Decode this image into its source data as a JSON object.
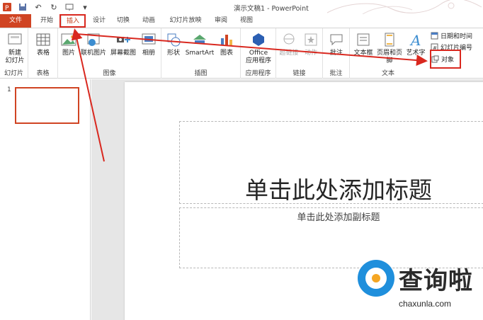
{
  "window": {
    "title": "演示文稿1 - PowerPoint"
  },
  "tabs": [
    {
      "label": "文件"
    },
    {
      "label": "开始"
    },
    {
      "label": "插入"
    },
    {
      "label": "设计"
    },
    {
      "label": "切换"
    },
    {
      "label": "动画"
    },
    {
      "label": "幻灯片放映"
    },
    {
      "label": "审阅"
    },
    {
      "label": "视图"
    }
  ],
  "ribbon": {
    "groups": {
      "slides": "幻灯片",
      "tables": "表格",
      "images": "图像",
      "illustrations": "插图",
      "apps": "应用程序",
      "links": "链接",
      "comments": "批注",
      "text": "文本"
    },
    "commands": {
      "new_slide_1": "新建",
      "new_slide_2": "幻灯片",
      "table": "表格",
      "pictures": "图片",
      "online_pictures": "联机图片",
      "screenshot": "屏幕截图",
      "album": "相册",
      "shapes": "形状",
      "smartart": "SmartArt",
      "chart": "图表",
      "office_1": "Office",
      "office_2": "应用程序",
      "hyperlink": "超链接",
      "action": "动作",
      "comment": "批注",
      "textbox": "文本框",
      "header_footer": "页眉和页脚",
      "wordart": "艺术字",
      "datetime": "日期和时间",
      "slide_number": "幻灯片编号",
      "object": "对象"
    }
  },
  "thumbnail": {
    "number": "1"
  },
  "slide": {
    "title": "单击此处添加标题",
    "subtitle": "单击此处添加副标题"
  },
  "watermark": {
    "name": "查询啦",
    "url": "chaxunla.com"
  },
  "colors": {
    "accent": "#d04423",
    "annotation": "#d9281f"
  }
}
